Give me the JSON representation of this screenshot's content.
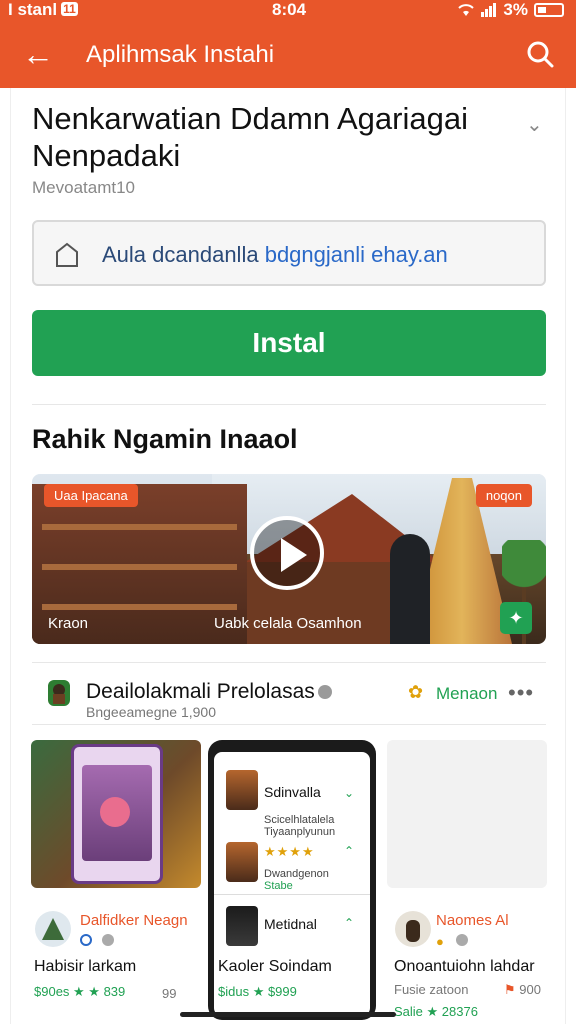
{
  "status_bar": {
    "carrier": "I stanl",
    "sim_badge": "11",
    "time": "8:04",
    "battery": "3%"
  },
  "app_bar": {
    "back_icon": "arrow-left-icon",
    "title": "Aplihmsak Instahi",
    "search_icon": "search-icon"
  },
  "app_detail": {
    "title": "Nenkarwatian Ddamn Agariagai Nenpadaki",
    "meta": "Mevoatamt10",
    "info_text": "Aula dcandanlla",
    "info_link": "bdgngjanli ehay.an",
    "install_label": "Instal"
  },
  "preview": {
    "heading": "Rahik Ngamin Inaaol",
    "tag_left": "Uaa Ipacana",
    "tag_right": "noqon",
    "caption_left": "Kraon",
    "caption_right": "Uabk celala Osamhon"
  },
  "developer": {
    "name": "Deailolakmali Prelolasas",
    "subtitle": "Bngeeamegne 1,900",
    "more_label": "Menaon"
  },
  "phone_cards": [
    {
      "name": "Sdinvalla",
      "sub": "Scicelhlatalela",
      "sub2": "Tiyaanplyunun",
      "stars": "★★★★",
      "note": "Dwandgenon",
      "note2": "Stabe"
    },
    {
      "name": "Metidnal"
    }
  ],
  "apps": [
    {
      "title": "Dalfidker Neagn",
      "subtitle": "Habisir larkam",
      "rating": "$90es ★ ★ 839",
      "extra": "99"
    },
    {
      "title": "",
      "subtitle": "Kaoler Soindam",
      "rating": "$idus ★ $999",
      "extra": ""
    },
    {
      "title": "Naomes Al",
      "subtitle": "Onoantuiohn lahdar",
      "rating": "Salie ★ 28376",
      "extra": "Fusie zatoon",
      "extra2": "900"
    }
  ],
  "colors": {
    "brand": "#e8562a",
    "install_green": "#21a153",
    "link_blue": "#2a69c8"
  }
}
